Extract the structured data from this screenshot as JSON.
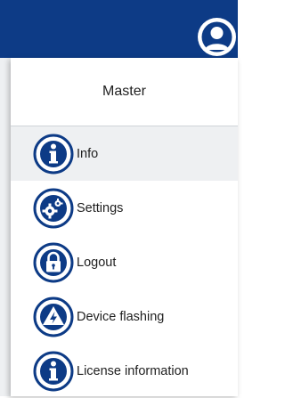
{
  "colors": {
    "topbar": "#0d3b86",
    "icon_blue": "#0d3b86",
    "active_row": "#eef0f2"
  },
  "topbar": {
    "avatar_icon": "user-avatar-icon"
  },
  "user_menu": {
    "user_name": "Master",
    "items": [
      {
        "label": "Info",
        "icon": "info-icon",
        "active": true
      },
      {
        "label": "Settings",
        "icon": "gears-icon",
        "active": false
      },
      {
        "label": "Logout",
        "icon": "lock-icon",
        "active": false
      },
      {
        "label": "Device flashing",
        "icon": "warning-lightning-icon",
        "active": false
      },
      {
        "label": "License information",
        "icon": "info-icon",
        "active": false
      }
    ]
  }
}
